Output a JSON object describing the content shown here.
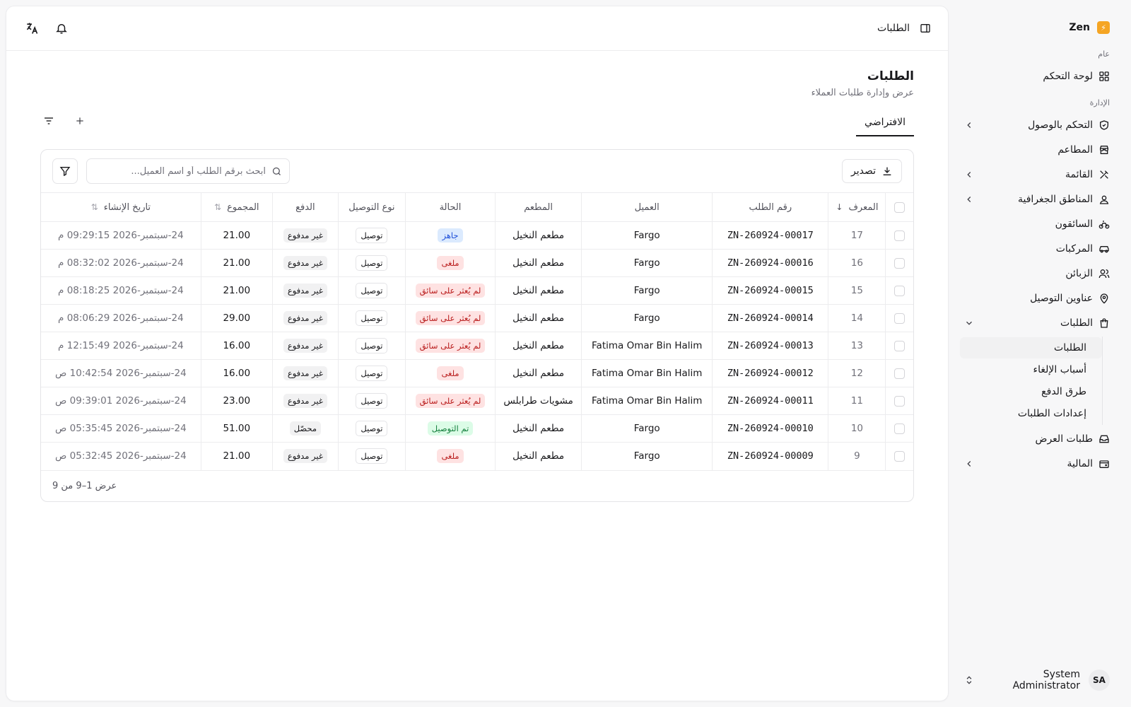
{
  "brand": {
    "name": "Zen",
    "logo_glyph": "⚡",
    "accent": "#f5a524"
  },
  "sidebar": {
    "groups": [
      {
        "label": "عام"
      },
      {
        "label": "الإدارة"
      }
    ],
    "items": [
      {
        "label": "لوحة التحكم",
        "icon": "grid-icon"
      },
      {
        "label": "التحكم بالوصول",
        "icon": "shield-check-icon"
      },
      {
        "label": "المطاعم",
        "icon": "store-icon"
      },
      {
        "label": "القائمة",
        "icon": "utensils-icon"
      },
      {
        "label": "المناطق الجغرافية",
        "icon": "map-user-icon"
      },
      {
        "label": "السائقون",
        "icon": "bike-icon"
      },
      {
        "label": "المركبات",
        "icon": "car-icon"
      },
      {
        "label": "الزبائن",
        "icon": "users-icon"
      },
      {
        "label": "عناوين التوصيل",
        "icon": "map-pin-icon"
      },
      {
        "label": "الطلبات",
        "icon": "shopping-bag-icon"
      },
      {
        "label": "طلبات العرض",
        "icon": "inbox-icon"
      },
      {
        "label": "المالية",
        "icon": "wallet-icon"
      }
    ],
    "orders_sub": [
      {
        "label": "الطلبات"
      },
      {
        "label": "أسباب الإلغاء"
      },
      {
        "label": "طرق الدفع"
      },
      {
        "label": "إعدادات الطلبات"
      }
    ],
    "user": {
      "initials": "SA",
      "name": "System Administrator"
    }
  },
  "topbar": {
    "breadcrumb": "الطلبات"
  },
  "page": {
    "title": "الطلبات",
    "subtitle": "عرض وإدارة طلبات العملاء",
    "tab_default": "الافتراضي"
  },
  "toolbar": {
    "export_label": "تصدير",
    "search_placeholder": "ابحث برقم الطلب أو اسم العميل..."
  },
  "table": {
    "columns": {
      "id": "المعرف",
      "order_no": "رقم الطلب",
      "customer": "العميل",
      "restaurant": "المطعم",
      "status": "الحالة",
      "delivery_type": "نوع التوصيل",
      "payment": "الدفع",
      "total": "المجموع",
      "created_at": "تاريخ الإنشاء"
    },
    "rows": [
      {
        "id": "17",
        "order_no": "ZN-260924-00017",
        "customer": "Fargo",
        "restaurant": "مطعم النخيل",
        "status": "جاهز",
        "status_tone": "blue",
        "delivery_type": "توصيل",
        "payment": "غير مدفوع",
        "total": "21.00",
        "created_at": "24-سبتمبر-2026 09:29:15 م"
      },
      {
        "id": "16",
        "order_no": "ZN-260924-00016",
        "customer": "Fargo",
        "restaurant": "مطعم النخيل",
        "status": "ملغى",
        "status_tone": "red",
        "delivery_type": "توصيل",
        "payment": "غير مدفوع",
        "total": "21.00",
        "created_at": "24-سبتمبر-2026 08:32:02 م"
      },
      {
        "id": "15",
        "order_no": "ZN-260924-00015",
        "customer": "Fargo",
        "restaurant": "مطعم النخيل",
        "status": "لم يُعثر على سائق",
        "status_tone": "red",
        "delivery_type": "توصيل",
        "payment": "غير مدفوع",
        "total": "21.00",
        "created_at": "24-سبتمبر-2026 08:18:25 م"
      },
      {
        "id": "14",
        "order_no": "ZN-260924-00014",
        "customer": "Fargo",
        "restaurant": "مطعم النخيل",
        "status": "لم يُعثر على سائق",
        "status_tone": "red",
        "delivery_type": "توصيل",
        "payment": "غير مدفوع",
        "total": "29.00",
        "created_at": "24-سبتمبر-2026 08:06:29 م"
      },
      {
        "id": "13",
        "order_no": "ZN-260924-00013",
        "customer": "Fatima Omar Bin Halim",
        "restaurant": "مطعم النخيل",
        "status": "لم يُعثر على سائق",
        "status_tone": "red",
        "delivery_type": "توصيل",
        "payment": "غير مدفوع",
        "total": "16.00",
        "created_at": "24-سبتمبر-2026 12:15:49 م"
      },
      {
        "id": "12",
        "order_no": "ZN-260924-00012",
        "customer": "Fatima Omar Bin Halim",
        "restaurant": "مطعم النخيل",
        "status": "ملغى",
        "status_tone": "red",
        "delivery_type": "توصيل",
        "payment": "غير مدفوع",
        "total": "16.00",
        "created_at": "24-سبتمبر-2026 10:42:54 ص"
      },
      {
        "id": "11",
        "order_no": "ZN-260924-00011",
        "customer": "Fatima Omar Bin Halim",
        "restaurant": "مشويات طرابلس",
        "status": "لم يُعثر على سائق",
        "status_tone": "red",
        "delivery_type": "توصيل",
        "payment": "غير مدفوع",
        "total": "23.00",
        "created_at": "24-سبتمبر-2026 09:39:01 ص"
      },
      {
        "id": "10",
        "order_no": "ZN-260924-00010",
        "customer": "Fargo",
        "restaurant": "مطعم النخيل",
        "status": "تم التوصيل",
        "status_tone": "green",
        "delivery_type": "توصيل",
        "payment": "محصّل",
        "total": "51.00",
        "created_at": "24-سبتمبر-2026 05:35:45 ص"
      },
      {
        "id": "9",
        "order_no": "ZN-260924-00009",
        "customer": "Fargo",
        "restaurant": "مطعم النخيل",
        "status": "ملغى",
        "status_tone": "red",
        "delivery_type": "توصيل",
        "payment": "غير مدفوع",
        "total": "21.00",
        "created_at": "24-سبتمبر-2026 05:32:45 ص"
      }
    ]
  },
  "footer": {
    "range_text": "عرض 1–9 من 9"
  }
}
